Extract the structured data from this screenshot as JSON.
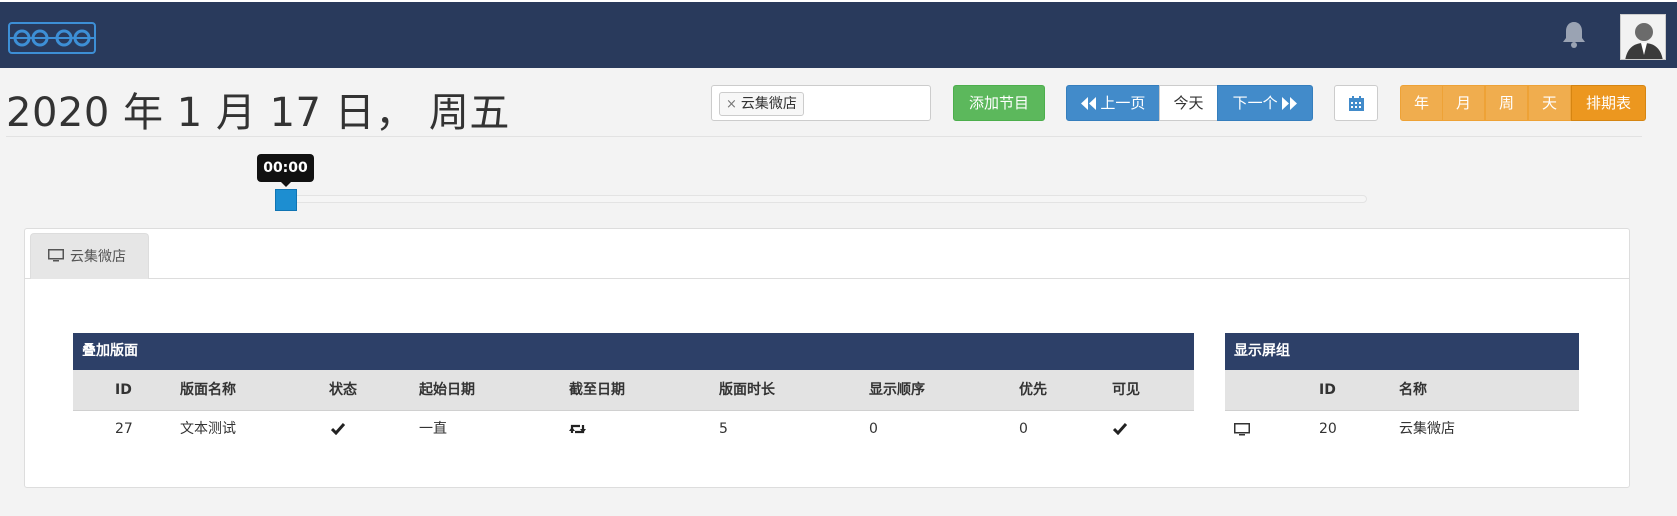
{
  "navbar": {
    "logo_text": "xibo",
    "bell_icon": "bell-icon",
    "avatar_icon": "user-avatar-icon"
  },
  "header": {
    "date_title": "2020 年 1 月 17 日， 周五",
    "display_filter": {
      "selected_tag": "云集微店",
      "remove_symbol": "×"
    },
    "add_event_label": "添加节目",
    "prev_label": "上一页",
    "today_label": "今天",
    "next_label": "下一个",
    "calendar_icon": "calendar-icon",
    "view_buttons": {
      "year": "年",
      "month": "月",
      "week": "周",
      "day": "天",
      "schedule": "排期表"
    }
  },
  "slider": {
    "tooltip": "00:00",
    "position_fraction": 0.0
  },
  "panel": {
    "tab_label": "云集微店",
    "tab_icon": "monitor-icon",
    "layouts_table": {
      "title": "叠加版面",
      "columns": [
        "ID",
        "版面名称",
        "状态",
        "起始日期",
        "截至日期",
        "版面时长",
        "显示顺序",
        "优先",
        "可见"
      ],
      "rows": [
        {
          "id": "27",
          "name": "文本测试",
          "status_icon": "check-icon",
          "from": "一直",
          "to_icon": "retweet-icon",
          "duration": "5",
          "display_order": "0",
          "priority": "0",
          "visible_icon": "check-icon"
        }
      ]
    },
    "groups_table": {
      "title": "显示屏组",
      "columns": [
        "",
        "ID",
        "名称"
      ],
      "rows": [
        {
          "icon": "monitor-icon",
          "id": "20",
          "name": "云集微店"
        }
      ]
    }
  },
  "colors": {
    "navbar": "#293a5c",
    "table_title": "#2d4068",
    "success": "#5cb85c",
    "primary": "#428bca",
    "warning": "#f0ad4e",
    "warning_active": "#ec971f",
    "slider_handle": "#1d8ed1"
  }
}
